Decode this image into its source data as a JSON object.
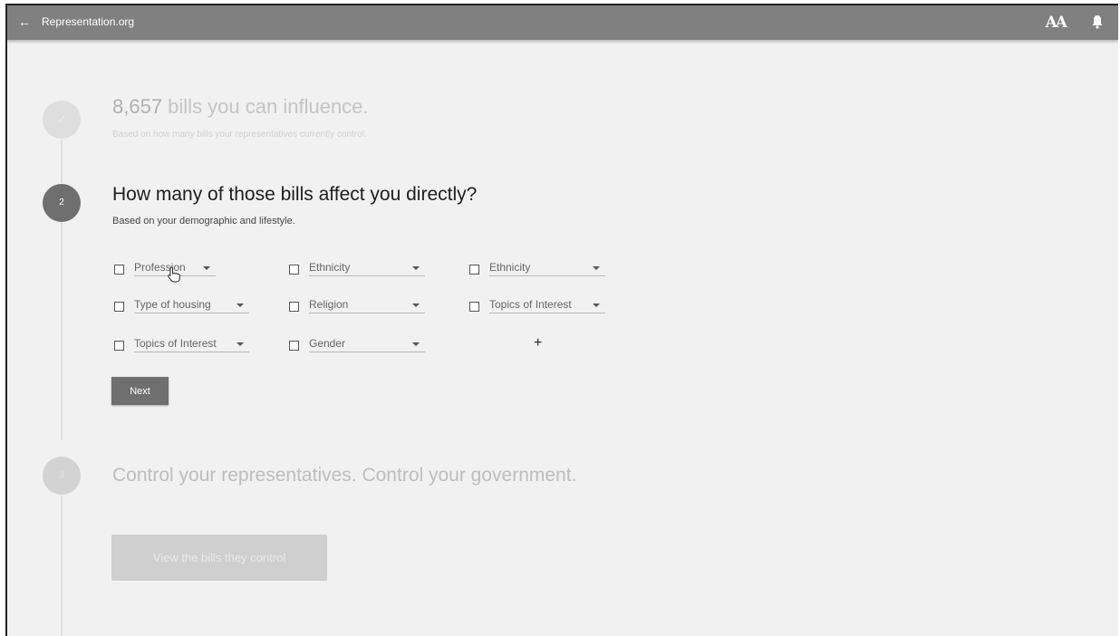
{
  "header": {
    "title": "Representation.org",
    "back_icon": "arrow-left-icon",
    "font_size_icon": "AA",
    "notification_icon": "bell-icon"
  },
  "steps": {
    "one": {
      "count": "8,657",
      "title_rest": " bills you can influence.",
      "subtitle": "Based on how many bills your representatives currently control.",
      "marker": "✓"
    },
    "two": {
      "number": "2",
      "title": "How many of those bills affect you directly?",
      "subtitle": "Based on your demographic and lifestyle.",
      "fields": [
        {
          "label": "Profession",
          "checked": false
        },
        {
          "label": "Ethnicity",
          "checked": false
        },
        {
          "label": "Ethnicity",
          "checked": false
        },
        {
          "label": "Type of housing",
          "checked": false
        },
        {
          "label": "Religion",
          "checked": false
        },
        {
          "label": "Topics of Interest",
          "checked": false
        },
        {
          "label": "Topics of Interest",
          "checked": false
        },
        {
          "label": "Gender",
          "checked": false
        }
      ],
      "add_label": "+",
      "next_label": "Next"
    },
    "three": {
      "number": "3",
      "title": "Control your representatives. Control your government.",
      "button_label": "View the bills they control"
    }
  },
  "colors": {
    "topbar": "#808080",
    "background": "#f1f1f1",
    "active_step": "#6f6f6f",
    "inactive_step": "#d3d3d3"
  }
}
